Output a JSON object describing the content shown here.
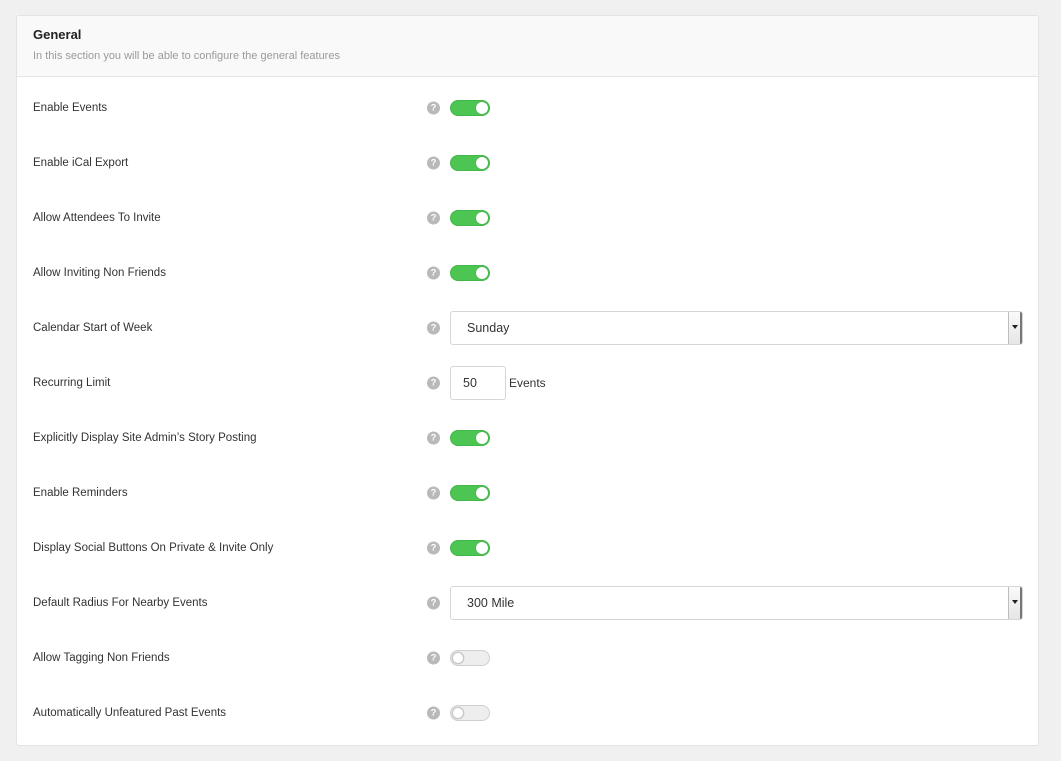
{
  "section": {
    "title": "General",
    "description": "In this section you will be able to configure the general features"
  },
  "colors": {
    "toggle_on": "#4cc552",
    "toggle_off": "#eeeeee",
    "help_icon": "#b9b9b9"
  },
  "help_icon_glyph": "?",
  "settings": [
    {
      "label": "Enable Events",
      "type": "toggle",
      "on": true
    },
    {
      "label": "Enable iCal Export",
      "type": "toggle",
      "on": true
    },
    {
      "label": "Allow Attendees To Invite",
      "type": "toggle",
      "on": true
    },
    {
      "label": "Allow Inviting Non Friends",
      "type": "toggle",
      "on": true
    },
    {
      "label": "Calendar Start of Week",
      "type": "select",
      "value": "Sunday"
    },
    {
      "label": "Recurring Limit",
      "type": "number",
      "value": "50",
      "unit": "Events"
    },
    {
      "label": "Explicitly Display Site Admin’s Story Posting",
      "type": "toggle",
      "on": true
    },
    {
      "label": "Enable Reminders",
      "type": "toggle",
      "on": true
    },
    {
      "label": "Display Social Buttons On Private & Invite Only",
      "type": "toggle",
      "on": true
    },
    {
      "label": "Default Radius For Nearby Events",
      "type": "select",
      "value": "300 Mile"
    },
    {
      "label": "Allow Tagging Non Friends",
      "type": "toggle",
      "on": false
    },
    {
      "label": "Automatically Unfeatured Past Events",
      "type": "toggle",
      "on": false
    }
  ]
}
